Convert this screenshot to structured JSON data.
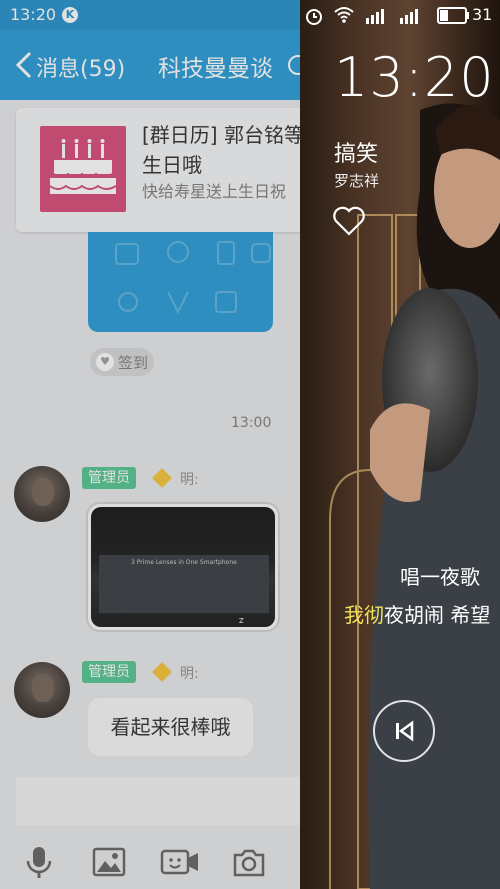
{
  "left_status": {
    "time": "13:20",
    "badge": "K"
  },
  "chat_header": {
    "back_label": "消息(59)",
    "title": "科技曼曼谈"
  },
  "calendar_card": {
    "title_line1": "[群日历] 郭台铭等",
    "title_line2": "生日哦",
    "subtitle": "快给寿星送上生日祝"
  },
  "signin": {
    "label": "签到"
  },
  "timestamp": "13:00",
  "messages": [
    {
      "tag": "管理员",
      "sender": "明:",
      "type": "image",
      "image_text": "3 Prime Lenses in One Smartphone"
    },
    {
      "tag": "管理员",
      "sender": "明:",
      "type": "text",
      "text": "看起来很棒哦"
    }
  ],
  "toolbar": [
    "microphone-icon",
    "image-icon",
    "video-icon",
    "camera-icon"
  ],
  "right_status": {
    "battery": "31"
  },
  "lock_screen": {
    "time": "13:20",
    "song": "搞笑",
    "artist": "罗志祥",
    "lyric_line1": "唱一夜歌 ",
    "lyric_line2_highlight": "我彻",
    "lyric_line2_rest": "夜胡闹 希望"
  },
  "colors": {
    "chat_blue": "#1a95d4",
    "admin_green": "#48c28a",
    "cake_pink": "#d63e6f",
    "lyric_highlight": "#f2e05a"
  }
}
